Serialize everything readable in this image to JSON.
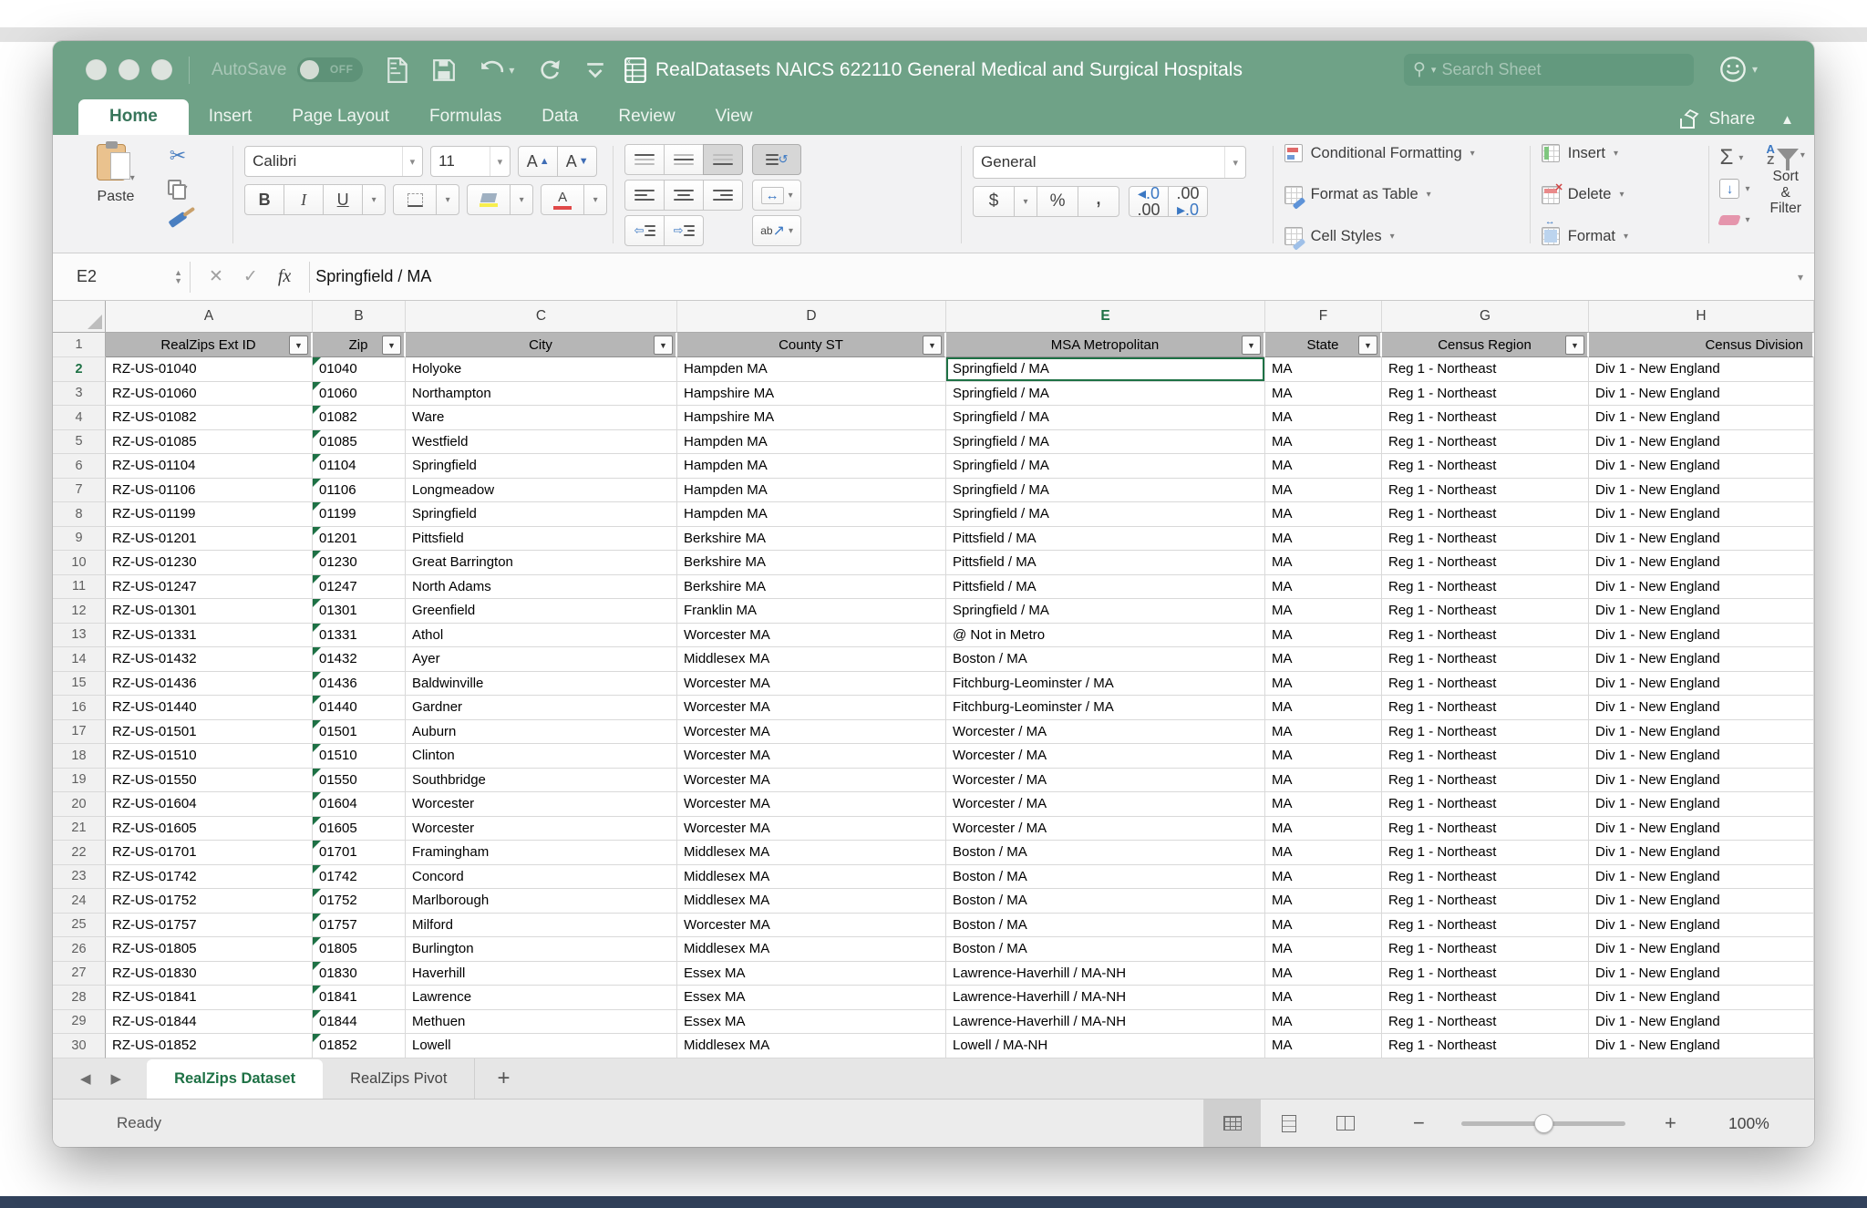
{
  "titlebar": {
    "autosave_label": "AutoSave",
    "autosave_state": "OFF",
    "title": "RealDatasets NAICS 622110 General Medical and Surgical Hospitals",
    "search_placeholder": "Search Sheet"
  },
  "ribbon_tabs": [
    {
      "label": "Home",
      "active": true
    },
    {
      "label": "Insert",
      "active": false
    },
    {
      "label": "Page Layout",
      "active": false
    },
    {
      "label": "Formulas",
      "active": false
    },
    {
      "label": "Data",
      "active": false
    },
    {
      "label": "Review",
      "active": false
    },
    {
      "label": "View",
      "active": false
    }
  ],
  "share_label": "Share",
  "ribbon": {
    "paste_label": "Paste",
    "font_name": "Calibri",
    "font_size": "11",
    "grow_font": "A",
    "shrink_font": "A",
    "bold": "B",
    "italic": "I",
    "underline": "U",
    "orientation": "ab",
    "number_format": "General",
    "currency": "$",
    "percent": "%",
    "comma": ",",
    "dec_inc_top": "◂.0",
    "dec_inc_bot": ".00",
    "dec_dec_top": ".00",
    "dec_dec_bot": "▸.0",
    "conditional_formatting": "Conditional Formatting",
    "format_as_table": "Format as Table",
    "cell_styles": "Cell Styles",
    "insert": "Insert",
    "delete": "Delete",
    "format": "Format",
    "sigma": "Σ",
    "sort_a": "A",
    "sort_z": "Z",
    "sort_filter_line1": "Sort &",
    "sort_filter_line2": "Filter"
  },
  "formula_bar": {
    "cell_ref": "E2",
    "fx_label": "fx",
    "value": "Springfield / MA"
  },
  "grid": {
    "column_letters": [
      "A",
      "B",
      "C",
      "D",
      "E",
      "F",
      "G",
      "H"
    ],
    "active_column": "E",
    "active_row": 2,
    "active_col_index": 4,
    "header_row": [
      "RealZips Ext ID",
      "Zip",
      "City",
      "County ST",
      "MSA Metropolitan",
      "State",
      "Census Region",
      "Census Division"
    ],
    "filter_columns": [
      true,
      true,
      true,
      true,
      true,
      true,
      true,
      false
    ],
    "rows": [
      {
        "n": 2,
        "cells": [
          "RZ-US-01040",
          "01040",
          "Holyoke",
          "Hampden MA",
          "Springfield / MA",
          "MA",
          "Reg 1 - Northeast",
          "Div 1 - New England"
        ]
      },
      {
        "n": 3,
        "cells": [
          "RZ-US-01060",
          "01060",
          "Northampton",
          "Hampshire MA",
          "Springfield / MA",
          "MA",
          "Reg 1 - Northeast",
          "Div 1 - New England"
        ]
      },
      {
        "n": 4,
        "cells": [
          "RZ-US-01082",
          "01082",
          "Ware",
          "Hampshire MA",
          "Springfield / MA",
          "MA",
          "Reg 1 - Northeast",
          "Div 1 - New England"
        ]
      },
      {
        "n": 5,
        "cells": [
          "RZ-US-01085",
          "01085",
          "Westfield",
          "Hampden MA",
          "Springfield / MA",
          "MA",
          "Reg 1 - Northeast",
          "Div 1 - New England"
        ]
      },
      {
        "n": 6,
        "cells": [
          "RZ-US-01104",
          "01104",
          "Springfield",
          "Hampden MA",
          "Springfield / MA",
          "MA",
          "Reg 1 - Northeast",
          "Div 1 - New England"
        ]
      },
      {
        "n": 7,
        "cells": [
          "RZ-US-01106",
          "01106",
          "Longmeadow",
          "Hampden MA",
          "Springfield / MA",
          "MA",
          "Reg 1 - Northeast",
          "Div 1 - New England"
        ]
      },
      {
        "n": 8,
        "cells": [
          "RZ-US-01199",
          "01199",
          "Springfield",
          "Hampden MA",
          "Springfield / MA",
          "MA",
          "Reg 1 - Northeast",
          "Div 1 - New England"
        ]
      },
      {
        "n": 9,
        "cells": [
          "RZ-US-01201",
          "01201",
          "Pittsfield",
          "Berkshire MA",
          "Pittsfield / MA",
          "MA",
          "Reg 1 - Northeast",
          "Div 1 - New England"
        ]
      },
      {
        "n": 10,
        "cells": [
          "RZ-US-01230",
          "01230",
          "Great Barrington",
          "Berkshire MA",
          "Pittsfield / MA",
          "MA",
          "Reg 1 - Northeast",
          "Div 1 - New England"
        ]
      },
      {
        "n": 11,
        "cells": [
          "RZ-US-01247",
          "01247",
          "North Adams",
          "Berkshire MA",
          "Pittsfield / MA",
          "MA",
          "Reg 1 - Northeast",
          "Div 1 - New England"
        ]
      },
      {
        "n": 12,
        "cells": [
          "RZ-US-01301",
          "01301",
          "Greenfield",
          "Franklin MA",
          "Springfield / MA",
          "MA",
          "Reg 1 - Northeast",
          "Div 1 - New England"
        ]
      },
      {
        "n": 13,
        "cells": [
          "RZ-US-01331",
          "01331",
          "Athol",
          "Worcester MA",
          "@ Not in Metro",
          "MA",
          "Reg 1 - Northeast",
          "Div 1 - New England"
        ]
      },
      {
        "n": 14,
        "cells": [
          "RZ-US-01432",
          "01432",
          "Ayer",
          "Middlesex MA",
          "Boston / MA",
          "MA",
          "Reg 1 - Northeast",
          "Div 1 - New England"
        ]
      },
      {
        "n": 15,
        "cells": [
          "RZ-US-01436",
          "01436",
          "Baldwinville",
          "Worcester MA",
          "Fitchburg-Leominster / MA",
          "MA",
          "Reg 1 - Northeast",
          "Div 1 - New England"
        ]
      },
      {
        "n": 16,
        "cells": [
          "RZ-US-01440",
          "01440",
          "Gardner",
          "Worcester MA",
          "Fitchburg-Leominster / MA",
          "MA",
          "Reg 1 - Northeast",
          "Div 1 - New England"
        ]
      },
      {
        "n": 17,
        "cells": [
          "RZ-US-01501",
          "01501",
          "Auburn",
          "Worcester MA",
          "Worcester / MA",
          "MA",
          "Reg 1 - Northeast",
          "Div 1 - New England"
        ]
      },
      {
        "n": 18,
        "cells": [
          "RZ-US-01510",
          "01510",
          "Clinton",
          "Worcester MA",
          "Worcester / MA",
          "MA",
          "Reg 1 - Northeast",
          "Div 1 - New England"
        ]
      },
      {
        "n": 19,
        "cells": [
          "RZ-US-01550",
          "01550",
          "Southbridge",
          "Worcester MA",
          "Worcester / MA",
          "MA",
          "Reg 1 - Northeast",
          "Div 1 - New England"
        ]
      },
      {
        "n": 20,
        "cells": [
          "RZ-US-01604",
          "01604",
          "Worcester",
          "Worcester MA",
          "Worcester / MA",
          "MA",
          "Reg 1 - Northeast",
          "Div 1 - New England"
        ]
      },
      {
        "n": 21,
        "cells": [
          "RZ-US-01605",
          "01605",
          "Worcester",
          "Worcester MA",
          "Worcester / MA",
          "MA",
          "Reg 1 - Northeast",
          "Div 1 - New England"
        ]
      },
      {
        "n": 22,
        "cells": [
          "RZ-US-01701",
          "01701",
          "Framingham",
          "Middlesex MA",
          "Boston / MA",
          "MA",
          "Reg 1 - Northeast",
          "Div 1 - New England"
        ]
      },
      {
        "n": 23,
        "cells": [
          "RZ-US-01742",
          "01742",
          "Concord",
          "Middlesex MA",
          "Boston / MA",
          "MA",
          "Reg 1 - Northeast",
          "Div 1 - New England"
        ]
      },
      {
        "n": 24,
        "cells": [
          "RZ-US-01752",
          "01752",
          "Marlborough",
          "Middlesex MA",
          "Boston / MA",
          "MA",
          "Reg 1 - Northeast",
          "Div 1 - New England"
        ]
      },
      {
        "n": 25,
        "cells": [
          "RZ-US-01757",
          "01757",
          "Milford",
          "Worcester MA",
          "Boston / MA",
          "MA",
          "Reg 1 - Northeast",
          "Div 1 - New England"
        ]
      },
      {
        "n": 26,
        "cells": [
          "RZ-US-01805",
          "01805",
          "Burlington",
          "Middlesex MA",
          "Boston / MA",
          "MA",
          "Reg 1 - Northeast",
          "Div 1 - New England"
        ]
      },
      {
        "n": 27,
        "cells": [
          "RZ-US-01830",
          "01830",
          "Haverhill",
          "Essex MA",
          "Lawrence-Haverhill / MA-NH",
          "MA",
          "Reg 1 - Northeast",
          "Div 1 - New England"
        ]
      },
      {
        "n": 28,
        "cells": [
          "RZ-US-01841",
          "01841",
          "Lawrence",
          "Essex MA",
          "Lawrence-Haverhill / MA-NH",
          "MA",
          "Reg 1 - Northeast",
          "Div 1 - New England"
        ]
      },
      {
        "n": 29,
        "cells": [
          "RZ-US-01844",
          "01844",
          "Methuen",
          "Essex MA",
          "Lawrence-Haverhill / MA-NH",
          "MA",
          "Reg 1 - Northeast",
          "Div 1 - New England"
        ]
      },
      {
        "n": 30,
        "cells": [
          "RZ-US-01852",
          "01852",
          "Lowell",
          "Middlesex MA",
          "Lowell / MA-NH",
          "MA",
          "Reg 1 - Northeast",
          "Div 1 - New England"
        ]
      }
    ]
  },
  "sheet_tabs": [
    {
      "label": "RealZips Dataset",
      "active": true
    },
    {
      "label": "RealZips Pivot",
      "active": false
    }
  ],
  "status_bar": {
    "status": "Ready",
    "zoom": "100%"
  }
}
